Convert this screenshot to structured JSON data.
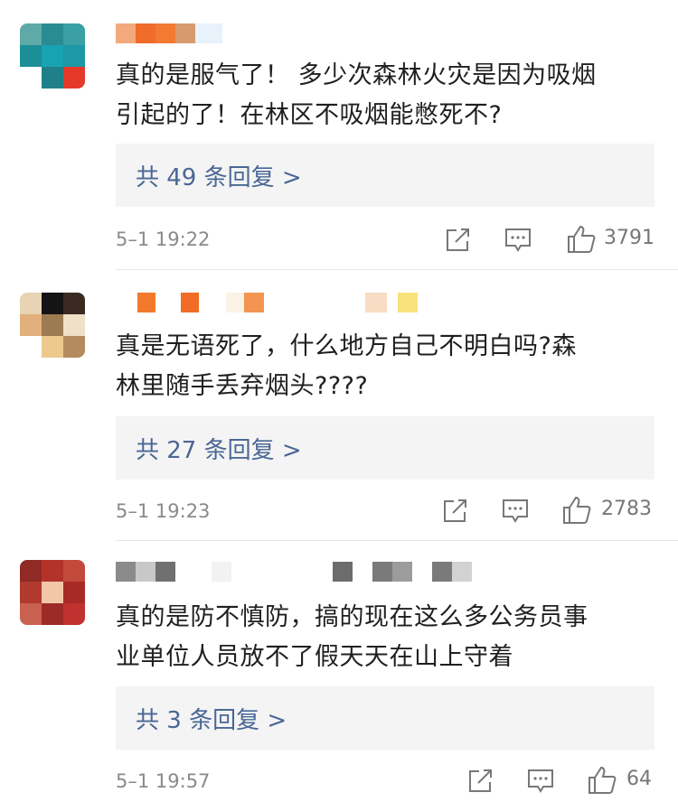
{
  "comments": [
    {
      "text_line1": "真的是服气了！ 多少次森林火灾是因为吸烟",
      "text_line2": "引起的了！在林区不吸烟能憋死不?",
      "reply_label": "共 49 条回复 >",
      "time": "5–1 19:22",
      "likes": "3791"
    },
    {
      "text_line1": "真是无语死了，什么地方自己不明白吗?森",
      "text_line2": "林里随手丢弃烟头????",
      "reply_label": "共 27 条回复 >",
      "time": "5–1 19:23",
      "likes": "2783"
    },
    {
      "text_line1": "真的是防不慎防，搞的现在这么多公务员事",
      "text_line2": "业单位人员放不了假天天在山上守着",
      "reply_label": "共 3 条回复 >",
      "time": "5–1 19:57",
      "likes": "64"
    }
  ],
  "icons": [
    "share-icon",
    "comment-icon",
    "like-icon"
  ],
  "colors": {
    "reply_link": "#4a6795",
    "meta_gray": "#8a8a8a",
    "reply_bg": "#f4f4f4"
  }
}
